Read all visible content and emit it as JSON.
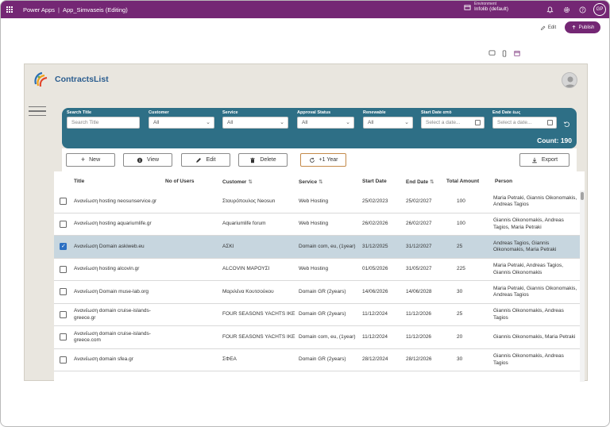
{
  "topbar": {
    "brand": "Power Apps",
    "separator": "|",
    "app_name": "App_Simvaseis (Editing)",
    "environment_label": "Environment",
    "environment_name": "Infolib (default)",
    "user_initials": "GP"
  },
  "editor": {
    "edit_label": "Edit",
    "publish_label": "Publish"
  },
  "app": {
    "title": "ContractsList"
  },
  "filters": {
    "search_title": {
      "label": "Search Title",
      "placeholder": "Search Title"
    },
    "customer": {
      "label": "Customer",
      "value": "All"
    },
    "service": {
      "label": "Service",
      "value": "All"
    },
    "approval_status": {
      "label": "Approval Status",
      "value": "All"
    },
    "renewable": {
      "label": "Renewable",
      "value": "All"
    },
    "start_date": {
      "label": "Start Date από",
      "placeholder": "Select a date..."
    },
    "end_date": {
      "label": "End Date έως",
      "placeholder": "Select a date..."
    },
    "count_label": "Count: 190"
  },
  "actions": {
    "new": "New",
    "view": "View",
    "edit": "Edit",
    "delete": "Delete",
    "plus_year": "+1 Year",
    "export": "Export"
  },
  "table": {
    "headers": {
      "title": "Title",
      "users": "No of Users",
      "customer": "Customer",
      "service": "Service",
      "start": "Start Date",
      "end": "End Date",
      "amount": "Total Amount",
      "person": "Person"
    },
    "rows": [
      {
        "title": "Ανανέωση hosting neosunservice.gr",
        "customer": "Σταυρόπουλος Neosun",
        "service": "Web Hosting",
        "start": "25/02/2023",
        "end": "25/02/2027",
        "amount": "100",
        "person": "Maria Petraki, Giannis Oikonomakis, Andreas Tagios",
        "checked": false
      },
      {
        "title": "Ανανέωση hosting aquariumlife.gr",
        "customer": "Aquariumlife forum",
        "service": "Web Hosting",
        "start": "26/02/2026",
        "end": "26/02/2027",
        "amount": "100",
        "person": "Giannis Oikonomakis, Andreas Tagios, Maria Petraki",
        "checked": false
      },
      {
        "title": "Ανανέωση Domain askiweb.eu",
        "customer": "ΑΣΚΙ",
        "service": "Domain com, eu, (1year)",
        "start": "31/12/2025",
        "end": "31/12/2027",
        "amount": "25",
        "person": "Andreas Tagios, Giannis Oikonomakis, Maria Petraki",
        "checked": true
      },
      {
        "title": "Ανανέωση hosting alcovin.gr",
        "customer": "ALCOVIN ΜΑΡΟΥΣΙ",
        "service": "Web Hosting",
        "start": "01/05/2026",
        "end": "31/05/2027",
        "amount": "225",
        "person": "Maria Petraki, Andreas Tagios, Giannis Oikonomakis",
        "checked": false
      },
      {
        "title": "Ανανέωση Domain  muse-lab.org",
        "customer": "Μαριλένα Κουτσούκου",
        "service": "Domain GR (2years)",
        "start": "14/06/2026",
        "end": "14/06/2028",
        "amount": "30",
        "person": "Maria Petraki, Giannis Oikonomakis, Andreas Tagios",
        "checked": false
      },
      {
        "title": "Ανανέωση domain cruise-islands-greece.gr",
        "customer": "FOUR SEASONS YACHTS IKE",
        "service": "Domain GR (2years)",
        "start": "11/12/2024",
        "end": "11/12/2026",
        "amount": "25",
        "person": "Giannis Oikonomakis, Andreas Tagios",
        "checked": false
      },
      {
        "title": "Ανανέωση domain cruise-islands-greece.com",
        "customer": "FOUR SEASONS YACHTS IKE",
        "service": "Domain com, eu, (1year)",
        "start": "11/12/2024",
        "end": "11/12/2026",
        "amount": "20",
        "person": "Giannis Oikonomakis, Maria Petraki",
        "checked": false
      },
      {
        "title": "Ανανέωση domain sfea.gr",
        "customer": "ΣΦΕΑ",
        "service": "Domain GR (2years)",
        "start": "28/12/2024",
        "end": "28/12/2026",
        "amount": "30",
        "person": "Giannis Oikonomakis, Andreas Tagios",
        "checked": false
      }
    ]
  },
  "colors": {
    "topbar": "#742774",
    "filter_panel": "#2e6f86",
    "selected_row": "#c7d6df",
    "canvas": "#e9e6df"
  },
  "icons": [
    "app-launcher-icon",
    "environment-icon",
    "bell-icon",
    "gear-icon",
    "help-icon",
    "pencil-icon",
    "publish-icon",
    "tablet-icon",
    "phone-icon",
    "calendar-icon",
    "app-logo",
    "user-avatar-icon",
    "hamburger-icon",
    "reset-icon",
    "plus-icon",
    "eye-icon",
    "trash-icon",
    "refresh-icon",
    "download-icon",
    "sort-icon"
  ]
}
